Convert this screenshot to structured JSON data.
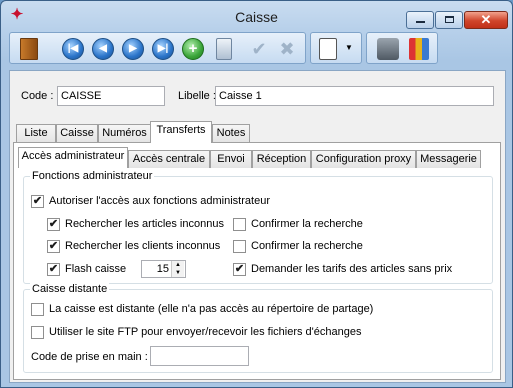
{
  "window": {
    "title": "Caisse"
  },
  "icons": {
    "app": "app-icon",
    "close": "close-icon",
    "minimize": "minimize-icon",
    "maximize": "maximize-icon"
  },
  "toolbar": {
    "exit": "door-exit-icon",
    "first": "first-record-icon",
    "previous": "previous-record-icon",
    "next": "next-record-icon",
    "last": "last-record-icon",
    "add": "add-icon",
    "delete": "delete-icon",
    "validate": "validate-icon",
    "cancel": "cancel-icon",
    "list_menu": "list-menu-icon",
    "print": "print-icon",
    "stats": "statistics-icon"
  },
  "header": {
    "code_label": "Code :",
    "code_value": "CAISSE",
    "libelle_label": "Libelle :",
    "libelle_value": "Caisse 1"
  },
  "tabs": [
    "Liste",
    "Caisse",
    "Numéros",
    "Transferts",
    "Notes"
  ],
  "active_tab": "Transferts",
  "subtabs": [
    "Accès administrateur",
    "Accès centrale",
    "Envoi",
    "Réception",
    "Configuration proxy",
    "Messagerie"
  ],
  "active_subtab": "Accès administrateur",
  "admin": {
    "group_title": "Fonctions administrateur",
    "authorize_label": "Autoriser l'accès aux fonctions administrateur",
    "authorize_checked": true,
    "search_articles_label": "Rechercher les articles inconnus",
    "search_articles_checked": true,
    "confirm_articles_label": "Confirmer la recherche",
    "confirm_articles_checked": false,
    "search_clients_label": "Rechercher les clients inconnus",
    "search_clients_checked": true,
    "confirm_clients_label": "Confirmer la recherche",
    "confirm_clients_checked": false,
    "flash_label": "Flash caisse",
    "flash_checked": true,
    "flash_value": "15",
    "tarifs_label": "Demander les tarifs des articles sans prix",
    "tarifs_checked": true
  },
  "remote": {
    "group_title": "Caisse distante",
    "distant_label": "La caisse est distante (elle n'a pas accès au répertoire de partage)",
    "distant_checked": false,
    "ftp_label": "Utiliser le site FTP pour envoyer/recevoir les fichiers d'échanges",
    "ftp_checked": false,
    "code_label": "Code de prise en main :",
    "code_value": ""
  }
}
